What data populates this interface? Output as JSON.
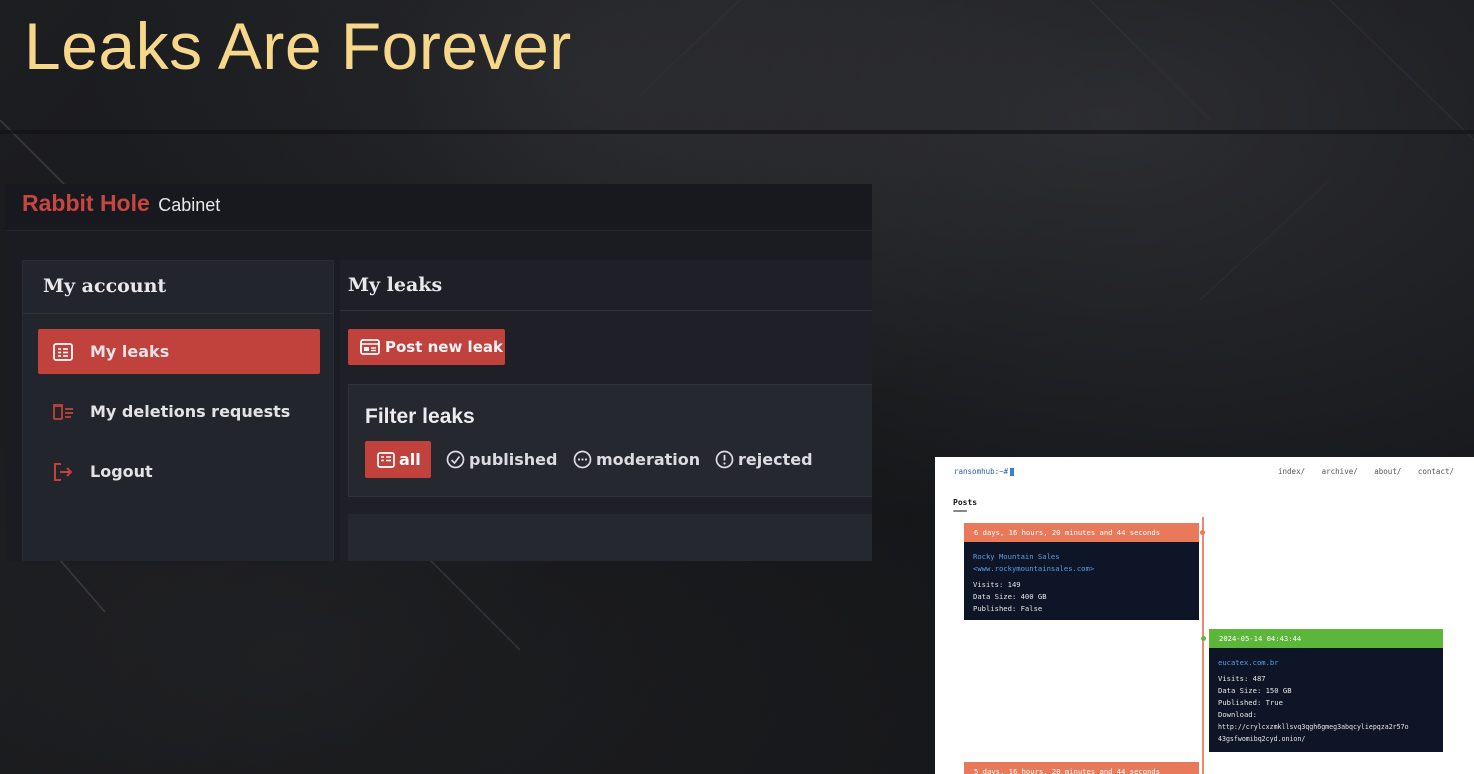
{
  "slide": {
    "title": "Leaks Are Forever"
  },
  "cabinet": {
    "brand_name": "Rabbit Hole",
    "brand_sub": "Cabinet",
    "sidebar": {
      "title": "My account",
      "items": [
        {
          "label": "My leaks",
          "icon": "list-icon",
          "active": true
        },
        {
          "label": "My deletions requests",
          "icon": "trash-list-icon",
          "active": false
        },
        {
          "label": "Logout",
          "icon": "logout-icon",
          "active": false
        }
      ]
    },
    "main": {
      "title": "My leaks",
      "post_button": "Post new leak",
      "filter": {
        "title": "Filter leaks",
        "options": [
          {
            "label": "all",
            "icon": "list-icon",
            "active": true
          },
          {
            "label": "published",
            "icon": "check-circle-icon",
            "active": false
          },
          {
            "label": "moderation",
            "icon": "dots-circle-icon",
            "active": false
          },
          {
            "label": "rejected",
            "icon": "exclamation-circle-icon",
            "active": false
          }
        ]
      }
    },
    "accent": "#c1413d"
  },
  "ransomhub": {
    "prompt": "ransomhub:~#",
    "nav": [
      "index/",
      "archive/",
      "about/",
      "contact/"
    ],
    "posts_heading": "Posts",
    "posts_underline": "=====",
    "cards": [
      {
        "header": "6 days, 16 hours, 20 minutes and 44 seconds",
        "header_color": "#e8795a",
        "name": "Rocky Mountain Sales",
        "url": "<www.rockymountainsales.com>",
        "lines": [
          "Visits: 149",
          "Data Size: 400 GB",
          "Published: False"
        ]
      },
      {
        "header": "2024-05-14 04:43:44",
        "header_color": "#5cb63a",
        "name": "eucatex.com.br",
        "url": "",
        "lines": [
          "Visits: 487",
          "Data Size: 150 GB",
          "Published: True",
          "Download:",
          "http://crylcxzmkllsvq3qgh6gmeg3abqcyliepqza2r57o",
          "43gsfwomibq2cyd.onion/"
        ]
      },
      {
        "header": "5 days, 16 hours, 20 minutes and 44 seconds",
        "header_color": "#e8795a",
        "name": "",
        "url": "",
        "lines": []
      }
    ]
  }
}
